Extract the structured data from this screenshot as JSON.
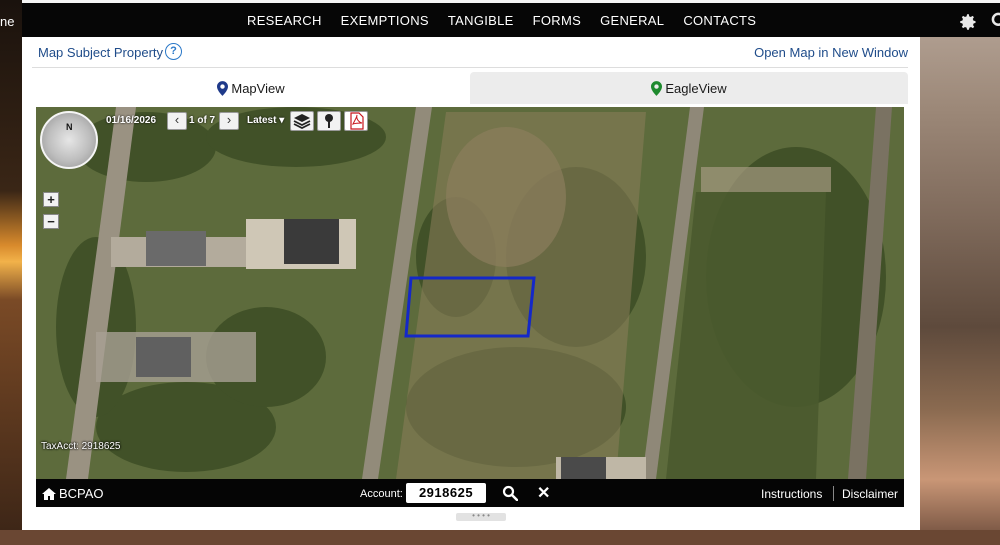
{
  "background": {
    "left_text": "ne"
  },
  "nav": {
    "items": [
      "RESEARCH",
      "EXEMPTIONS",
      "TANGIBLE",
      "FORMS",
      "GENERAL",
      "CONTACTS"
    ],
    "icons": [
      "gear-icon",
      "search-icon"
    ]
  },
  "panel": {
    "subject_link": "Map Subject Property",
    "help_icon": "?",
    "open_map_link": "Open Map in New Window",
    "tabs": [
      {
        "label": "MapView",
        "icon": "map-pin-icon",
        "icon_color": "#1f3a8a",
        "active": true
      },
      {
        "label": "EagleView",
        "icon": "map-pin-icon",
        "icon_color": "#1e8a2e",
        "active": false
      }
    ]
  },
  "map": {
    "compass_letter": "N",
    "zoom_in": "+",
    "zoom_out": "−",
    "date": "01/16/2026",
    "prev": "‹",
    "count": "1 of 7",
    "next": "›",
    "latest_label": "Latest ▾",
    "tools": [
      "layers-icon",
      "pin-icon",
      "pdf-icon"
    ],
    "tax_acct": "TaxAcct: 2918625",
    "parcel_outline_color": "#1428c8"
  },
  "footer": {
    "brand": "BCPAO",
    "account_label": "Account:",
    "account_value": "2918625",
    "instructions": "Instructions",
    "disclaimer": "Disclaimer"
  },
  "handle_text": "• • • •"
}
